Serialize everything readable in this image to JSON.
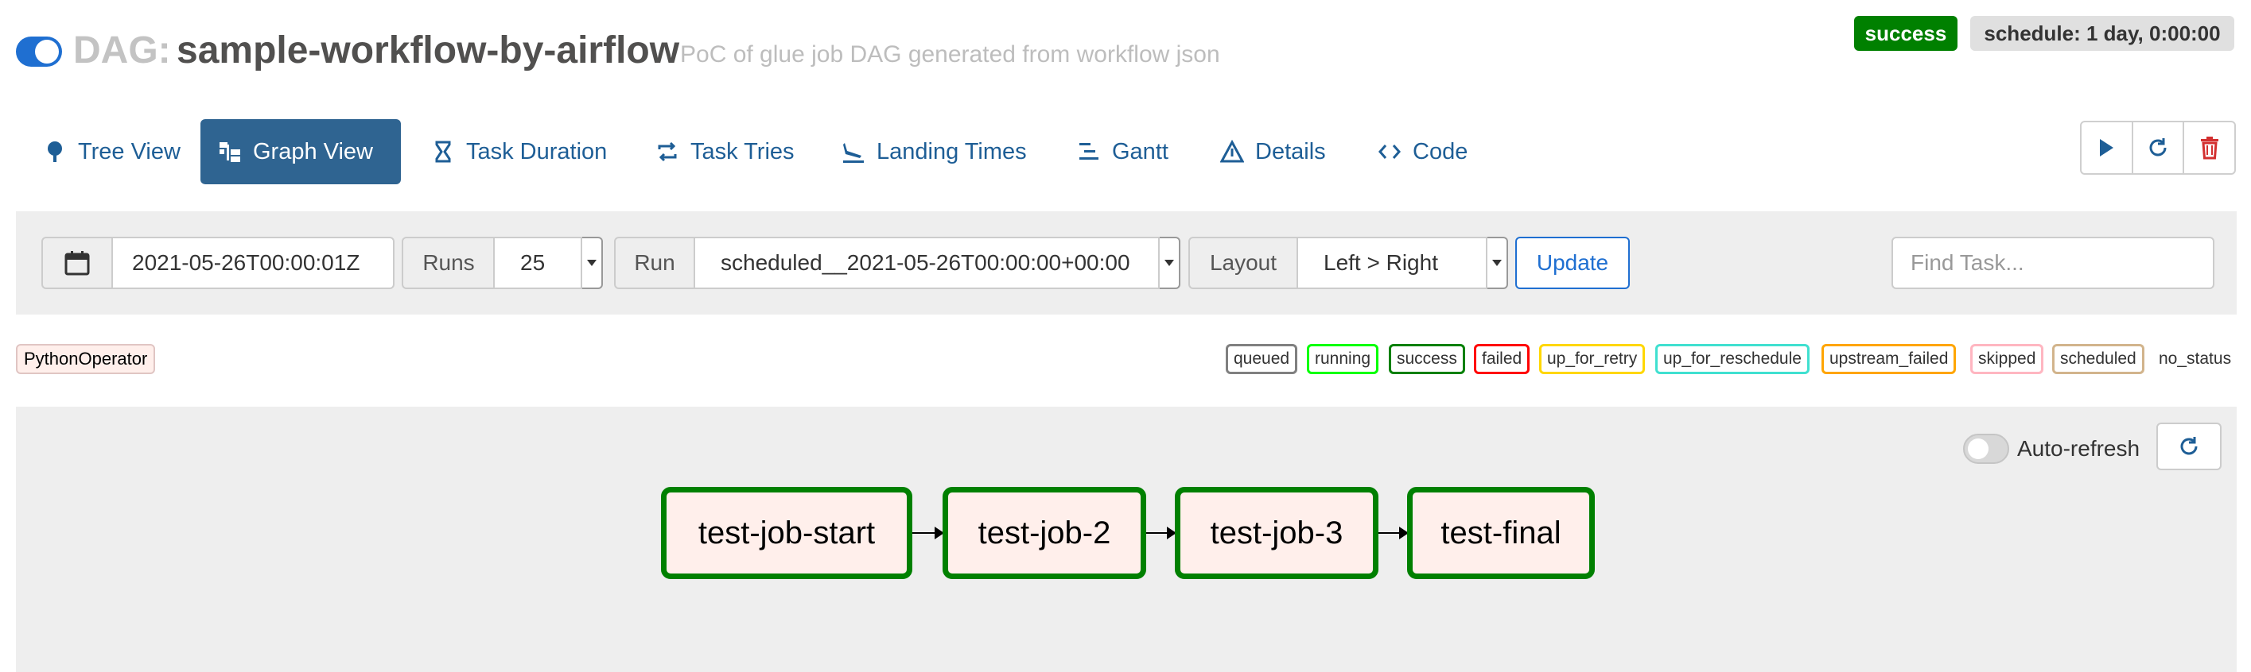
{
  "header": {
    "dag_prefix": "DAG:",
    "dag_name": "sample-workflow-by-airflow",
    "description": "PoC of glue job DAG generated from workflow json",
    "status_badge": "success",
    "schedule_badge": "schedule: 1 day, 0:00:00"
  },
  "tabs": [
    {
      "label": "Tree View",
      "icon": "tree-icon",
      "active": false
    },
    {
      "label": "Graph View",
      "icon": "graph-icon",
      "active": true
    },
    {
      "label": "Task Duration",
      "icon": "hourglass-icon",
      "active": false
    },
    {
      "label": "Task Tries",
      "icon": "retry-icon",
      "active": false
    },
    {
      "label": "Landing Times",
      "icon": "plane-landing-icon",
      "active": false
    },
    {
      "label": "Gantt",
      "icon": "gantt-icon",
      "active": false
    },
    {
      "label": "Details",
      "icon": "warning-icon",
      "active": false
    },
    {
      "label": "Code",
      "icon": "code-icon",
      "active": false
    }
  ],
  "filters": {
    "execution_date": "2021-05-26T00:00:01Z",
    "runs_label": "Runs",
    "runs_value": "25",
    "run_label": "Run",
    "run_value": "scheduled__2021-05-26T00:00:00+00:00",
    "layout_label": "Layout",
    "layout_value": "Left > Right",
    "update_label": "Update",
    "find_placeholder": "Find Task..."
  },
  "legend": {
    "operator": "PythonOperator",
    "operator_color": "#ffefeb",
    "states": [
      {
        "label": "queued",
        "color": "#808080"
      },
      {
        "label": "running",
        "color": "#00ff00"
      },
      {
        "label": "success",
        "color": "#008000"
      },
      {
        "label": "failed",
        "color": "#ff0000"
      },
      {
        "label": "up_for_retry",
        "color": "#ffd700"
      },
      {
        "label": "up_for_reschedule",
        "color": "#40e0d0"
      },
      {
        "label": "upstream_failed",
        "color": "#ffa500"
      },
      {
        "label": "skipped",
        "color": "#ffb6c1"
      },
      {
        "label": "scheduled",
        "color": "#d2b48c"
      }
    ],
    "no_status": "no_status"
  },
  "graph": {
    "auto_refresh_label": "Auto-refresh",
    "nodes": [
      {
        "label": "test-job-start",
        "state": "success"
      },
      {
        "label": "test-job-2",
        "state": "success"
      },
      {
        "label": "test-job-3",
        "state": "success"
      },
      {
        "label": "test-final",
        "state": "success"
      }
    ]
  }
}
